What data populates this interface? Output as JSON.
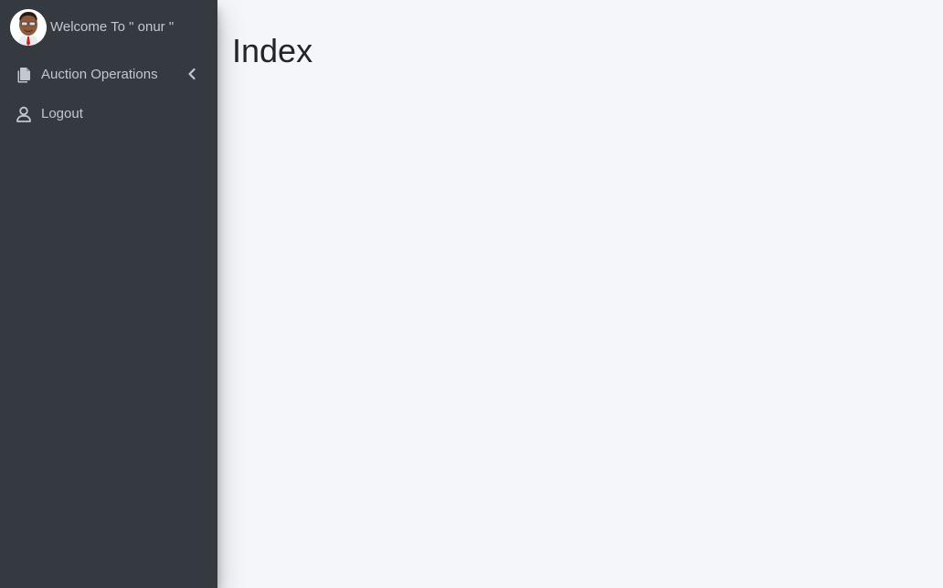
{
  "sidebar": {
    "user": {
      "welcome_text": "Welcome To \" onur \"",
      "avatar_icon": "user-avatar-icon"
    },
    "items": [
      {
        "label": "Auction Operations",
        "icon": "copy-icon",
        "has_submenu": true,
        "chevron_icon": "chevron-left-icon"
      },
      {
        "label": "Logout",
        "icon": "user-icon",
        "has_submenu": false
      }
    ]
  },
  "main": {
    "title": "Index"
  },
  "colors": {
    "sidebar_bg": "#343a40",
    "sidebar_text": "#c2c7d0",
    "content_bg": "#f4f6f9",
    "title_text": "#212529"
  }
}
